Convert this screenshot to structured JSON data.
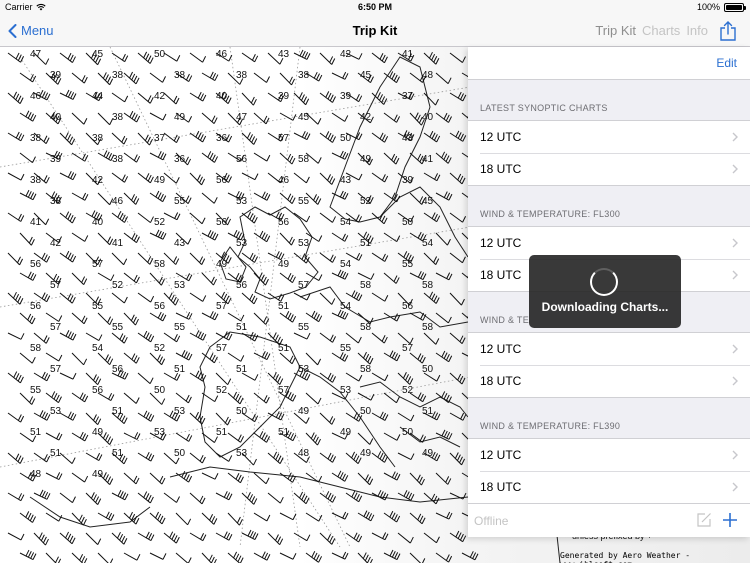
{
  "status_bar": {
    "carrier": "Carrier",
    "time": "6:50 PM",
    "battery": "100%",
    "battery_level": 1.0
  },
  "nav": {
    "back_label": "Menu",
    "title": "Trip Kit",
    "tabs": [
      {
        "label": "Trip Kit",
        "active": true
      },
      {
        "label": "Charts",
        "active": false
      },
      {
        "label": "Info",
        "active": false
      }
    ],
    "icons": {
      "back": "chevron-left-icon",
      "share": "share-icon"
    }
  },
  "panel": {
    "edit_label": "Edit",
    "sections": [
      {
        "header": "LATEST SYNOPTIC CHARTS",
        "rows": [
          "12 UTC",
          "18 UTC"
        ]
      },
      {
        "header": "WIND & TEMPERATURE: FL300",
        "rows": [
          "12 UTC",
          "18 UTC"
        ]
      },
      {
        "header": "WIND & TE",
        "rows": [
          "12 UTC",
          "18 UTC"
        ]
      },
      {
        "header": "WIND & TEMPERATURE: FL390",
        "rows": [
          "12 UTC",
          "18 UTC"
        ]
      }
    ],
    "toolbar": {
      "offline_label": "Offline",
      "icons": {
        "compose": "compose-icon",
        "add": "plus-icon"
      }
    }
  },
  "hud": {
    "message": "Downloading Charts..."
  },
  "map": {
    "footer": "Generated by Aero Weather - www.iblsoft.com",
    "partial_note": "unless prefixed by +",
    "labels": [
      "47",
      "45",
      "50",
      "46",
      "43",
      "42",
      "41",
      "39",
      "38",
      "38",
      "38",
      "38",
      "45",
      "48",
      "46",
      "44",
      "42",
      "40",
      "39",
      "39",
      "37",
      "40",
      "38",
      "49",
      "47",
      "45",
      "42",
      "40",
      "38",
      "38",
      "37",
      "36",
      "57",
      "50",
      "43",
      "39",
      "38",
      "36",
      "56",
      "58",
      "49",
      "41",
      "38",
      "42",
      "49",
      "56",
      "46",
      "43",
      "39",
      "38",
      "46",
      "55",
      "53",
      "55",
      "52",
      "45",
      "41",
      "40",
      "52",
      "56",
      "56",
      "54",
      "50",
      "42",
      "41",
      "43",
      "53",
      "53",
      "51",
      "54",
      "56",
      "57",
      "58",
      "49",
      "49",
      "54",
      "55",
      "57",
      "52",
      "53",
      "56",
      "57",
      "58",
      "58",
      "56",
      "55",
      "56",
      "57",
      "51",
      "54",
      "56",
      "57",
      "55",
      "55",
      "51",
      "55",
      "58",
      "58",
      "58",
      "54",
      "52",
      "57",
      "51",
      "55",
      "57",
      "57",
      "56",
      "51",
      "51",
      "53",
      "58",
      "50",
      "55",
      "56",
      "50",
      "52",
      "57",
      "53",
      "52",
      "53",
      "51",
      "53",
      "50",
      "49",
      "50",
      "51",
      "51",
      "49",
      "53",
      "51",
      "51",
      "49",
      "50",
      "51",
      "51",
      "50",
      "53",
      "48",
      "49",
      "49",
      "48",
      "49"
    ]
  }
}
